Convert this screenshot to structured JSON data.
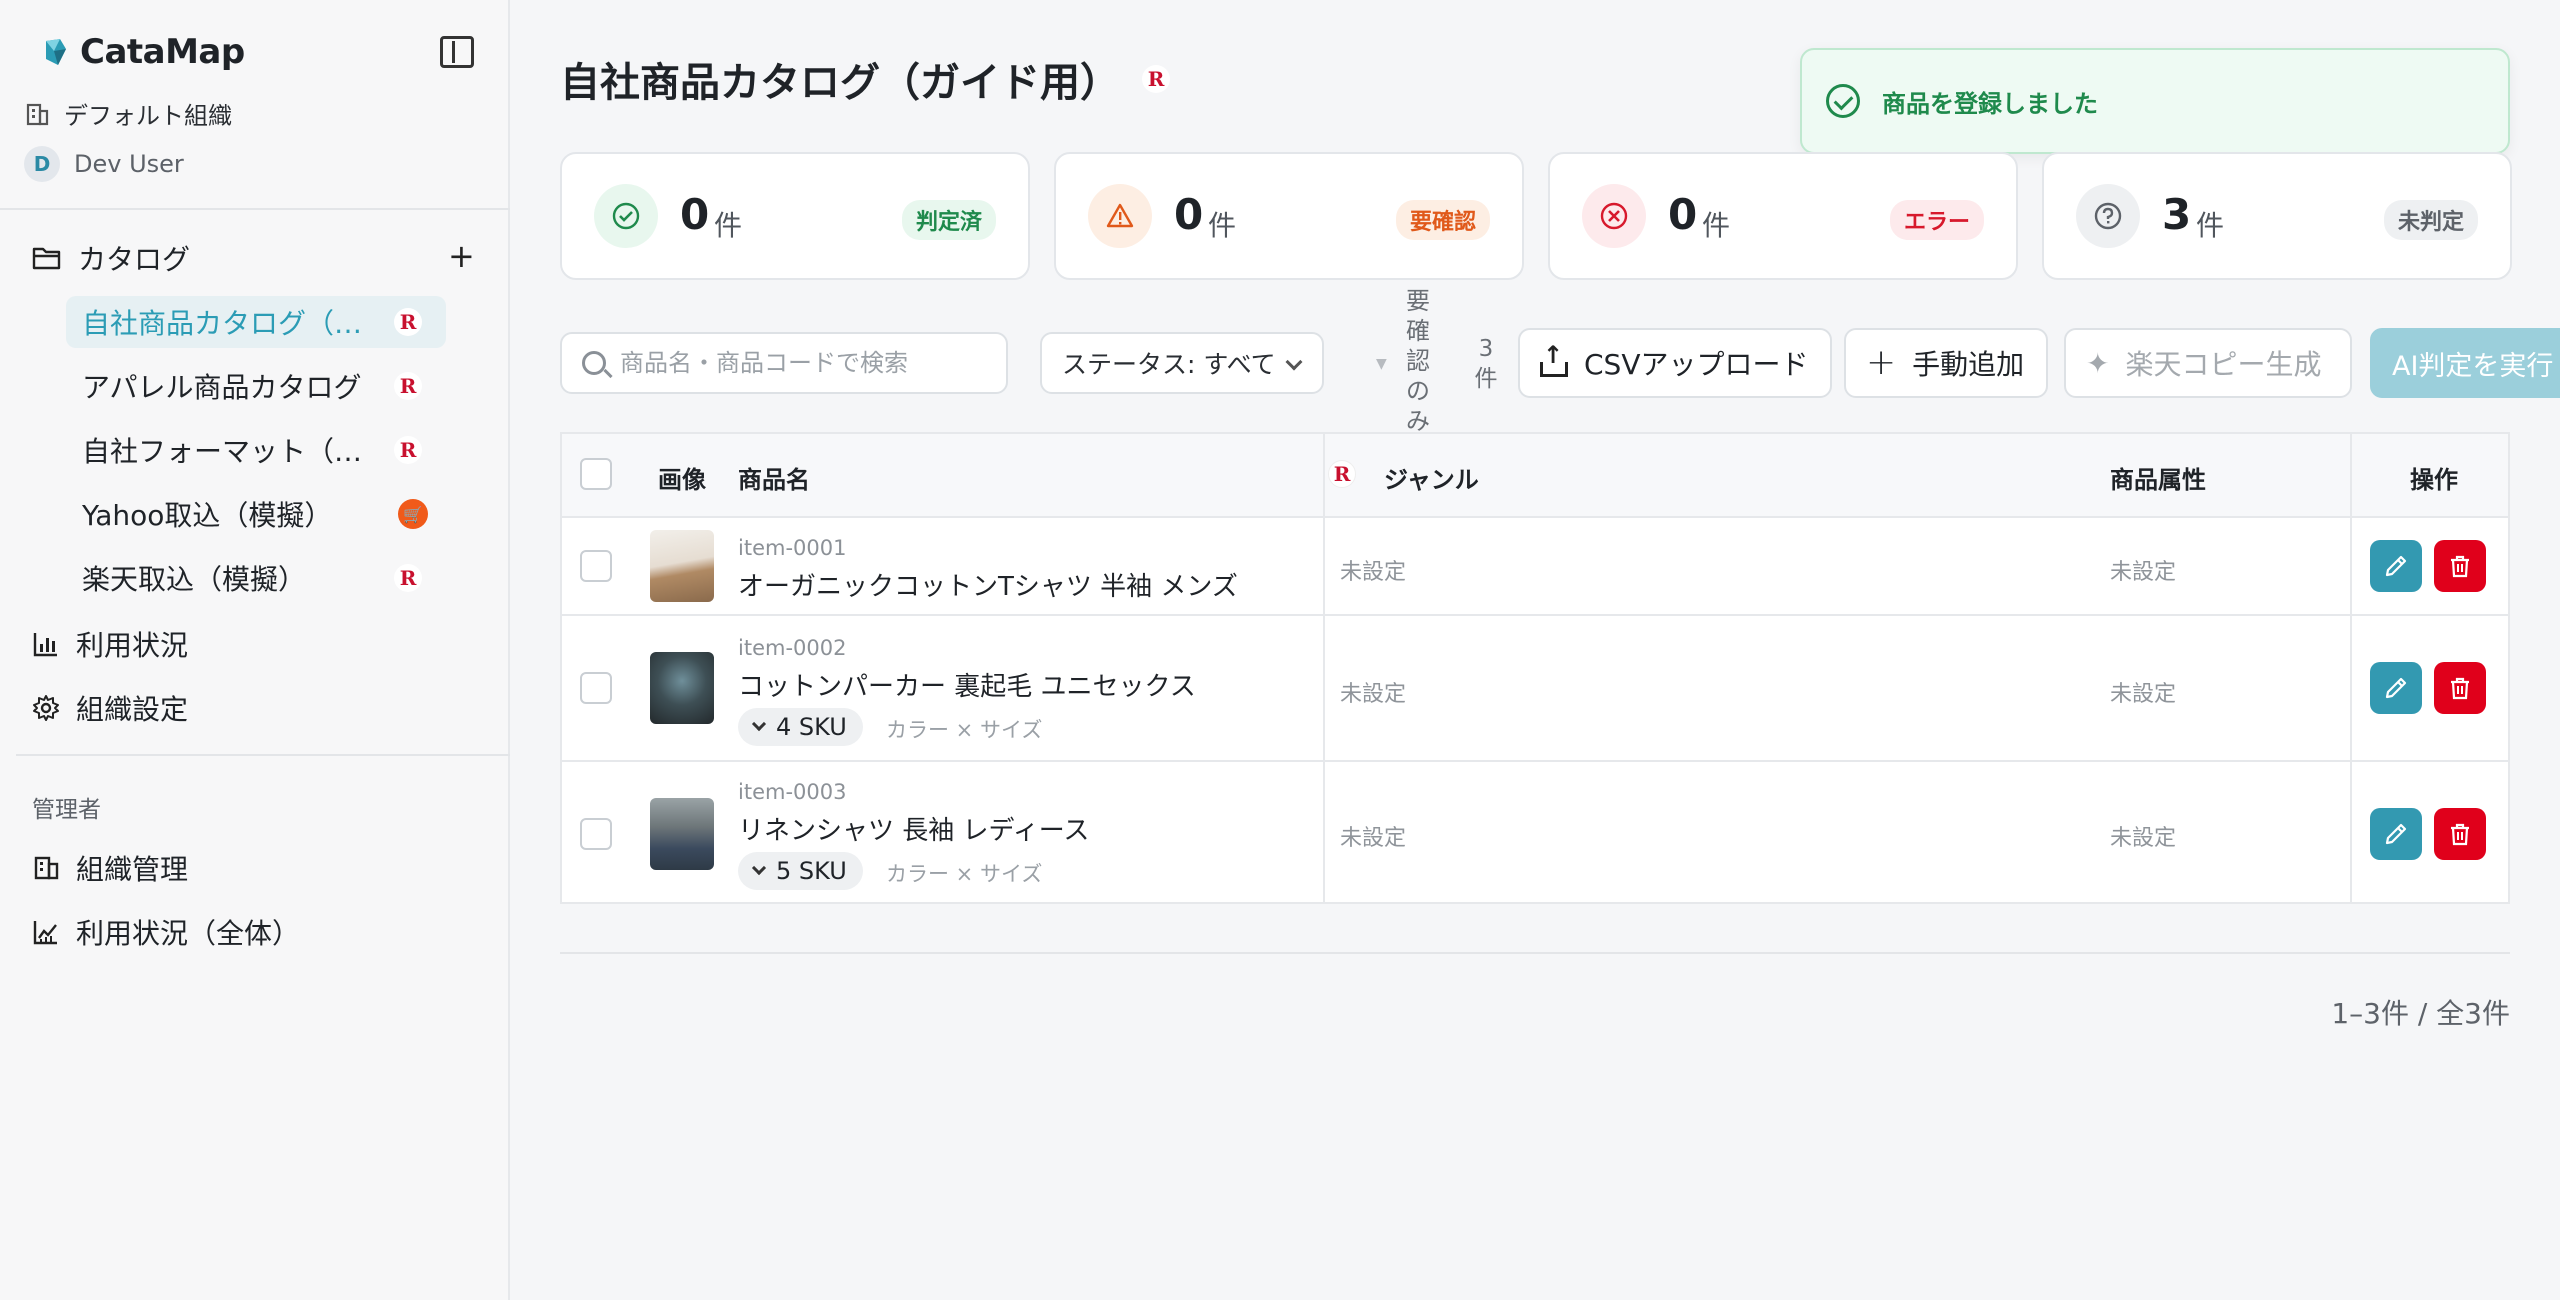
{
  "app": {
    "name": "CataMap"
  },
  "org": {
    "name": "デフォルト組織"
  },
  "user": {
    "initial": "D",
    "name": "Dev User"
  },
  "sidebar": {
    "catalog_label": "カタログ",
    "catalogs": [
      {
        "label": "自社商品カタログ（ガイド用）",
        "source": "rakuten",
        "active": true
      },
      {
        "label": "アパレル商品カタログ",
        "source": "rakuten",
        "active": false
      },
      {
        "label": "自社フォーマット（模擬）",
        "source": "rakuten",
        "active": false
      },
      {
        "label": "Yahoo取込（模擬）",
        "source": "yahoo",
        "active": false
      },
      {
        "label": "楽天取込（模擬）",
        "source": "rakuten",
        "active": false
      }
    ],
    "usage_label": "利用状況",
    "org_settings_label": "組織設定",
    "admin_section_label": "管理者",
    "org_admin_label": "組織管理",
    "usage_all_label": "利用状況（全体）"
  },
  "page": {
    "title": "自社商品カタログ（ガイド用）",
    "badge": "R"
  },
  "toast": {
    "message": "商品を登録しました"
  },
  "stats": [
    {
      "value": "0",
      "unit": "件",
      "label": "判定済",
      "icon": "check-circle-icon",
      "color": "#1f8a4c",
      "bg": "#e8f7ee"
    },
    {
      "value": "0",
      "unit": "件",
      "label": "要確認",
      "icon": "warning-icon",
      "color": "#e0591a",
      "bg": "#fdeee3"
    },
    {
      "value": "0",
      "unit": "件",
      "label": "エラー",
      "icon": "x-circle-icon",
      "color": "#d7192c",
      "bg": "#fdeaec"
    },
    {
      "value": "3",
      "unit": "件",
      "label": "未判定",
      "icon": "question-circle-icon",
      "color": "#5d6269",
      "bg": "#eef0f2"
    }
  ],
  "toolbar": {
    "search_placeholder": "商品名・商品コードで検索",
    "status_filter": "ステータス: すべて",
    "needs_review_only": "要確認のみ",
    "count_label": "3件",
    "csv_upload": "CSVアップロード",
    "manual_add": "手動追加",
    "rakuten_copy": "楽天コピー生成",
    "ai_judge": "AI判定を実行"
  },
  "table": {
    "headers": {
      "image": "画像",
      "name": "商品名",
      "genre": "ジャンル",
      "attributes": "商品属性",
      "actions": "操作"
    },
    "rows": [
      {
        "code": "item-0001",
        "name": "オーガニックコットンTシャツ 半袖 メンズ",
        "sku": "",
        "variant": "",
        "genre": "未設定",
        "attributes": "未設定"
      },
      {
        "code": "item-0002",
        "name": "コットンパーカー 裏起毛 ユニセックス",
        "sku": "4 SKU",
        "variant": "カラー × サイズ",
        "genre": "未設定",
        "attributes": "未設定"
      },
      {
        "code": "item-0003",
        "name": "リネンシャツ 長袖 レディース",
        "sku": "5 SKU",
        "variant": "カラー × サイズ",
        "genre": "未設定",
        "attributes": "未設定"
      }
    ]
  },
  "pagination": {
    "summary": "1–3件 / 全3件"
  },
  "colors": {
    "accent": "#2b9cb5",
    "danger": "#e0001b",
    "edit": "#3399b1",
    "ai_button": "#9bcfdb"
  }
}
